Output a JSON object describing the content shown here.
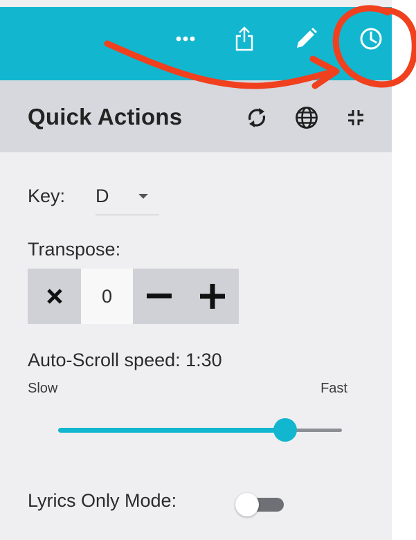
{
  "toolbar": {
    "more_icon": "more-horizontal-icon",
    "share_icon": "share-icon",
    "edit_icon": "pencil-icon",
    "history_icon": "clock-icon",
    "bar_color": "#13b6cf"
  },
  "quick_actions": {
    "title": "Quick Actions",
    "icons": [
      "refresh-icon",
      "globe-icon",
      "collapse-icon"
    ]
  },
  "key": {
    "label": "Key:",
    "value": "D"
  },
  "transpose": {
    "label": "Transpose:",
    "value": "0",
    "reset_icon": "close-icon",
    "decrement_icon": "minus-icon",
    "increment_icon": "plus-icon"
  },
  "auto_scroll": {
    "label": "Auto-Scroll speed: 1:30",
    "min_label": "Slow",
    "max_label": "Fast",
    "position_fraction": 0.8
  },
  "lyrics_only": {
    "label": "Lyrics Only Mode:",
    "enabled": false
  },
  "annotation": {
    "color": "#f0401e",
    "shapes": [
      "arrow",
      "circle"
    ]
  }
}
